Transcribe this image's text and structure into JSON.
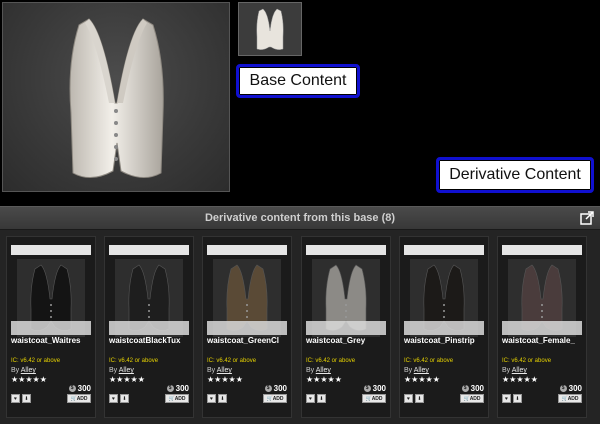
{
  "labels": {
    "base": "Base Content",
    "derivative": "Derivative Content"
  },
  "section": {
    "title": "Derivative content from this base (8)"
  },
  "cards": [
    {
      "name": "waistcoat_Waitres",
      "ic": "IC: v6.42 or above",
      "by": "By",
      "author": "Alley",
      "stars": "★★★★★",
      "price": "300",
      "add": "ADD",
      "color": "#141414"
    },
    {
      "name": "waistcoatBlackTux",
      "ic": "IC: v6.42 or above",
      "by": "By",
      "author": "Alley",
      "stars": "★★★★★",
      "price": "300",
      "add": "ADD",
      "color": "#1e1e1e"
    },
    {
      "name": "waistcoat_GreenCl",
      "ic": "IC: v6.42 or above",
      "by": "By",
      "author": "Alley",
      "stars": "★★★★★",
      "price": "300",
      "add": "ADD",
      "color": "#5a4a36"
    },
    {
      "name": "waistcoat_Grey",
      "ic": "IC: v6.42 or above",
      "by": "By",
      "author": "Alley",
      "stars": "★★★★★",
      "price": "300",
      "add": "ADD",
      "color": "#8c8a86"
    },
    {
      "name": "waistcoat_Pinstrip",
      "ic": "IC: v6.42 or above",
      "by": "By",
      "author": "Alley",
      "stars": "★★★★★",
      "price": "300",
      "add": "ADD",
      "color": "#1c1a18"
    },
    {
      "name": "waistcoat_Female_",
      "ic": "IC: v6.42 or above",
      "by": "By",
      "author": "Alley",
      "stars": "★★★★★",
      "price": "300",
      "add": "ADD",
      "color": "#4a3c3c"
    }
  ]
}
